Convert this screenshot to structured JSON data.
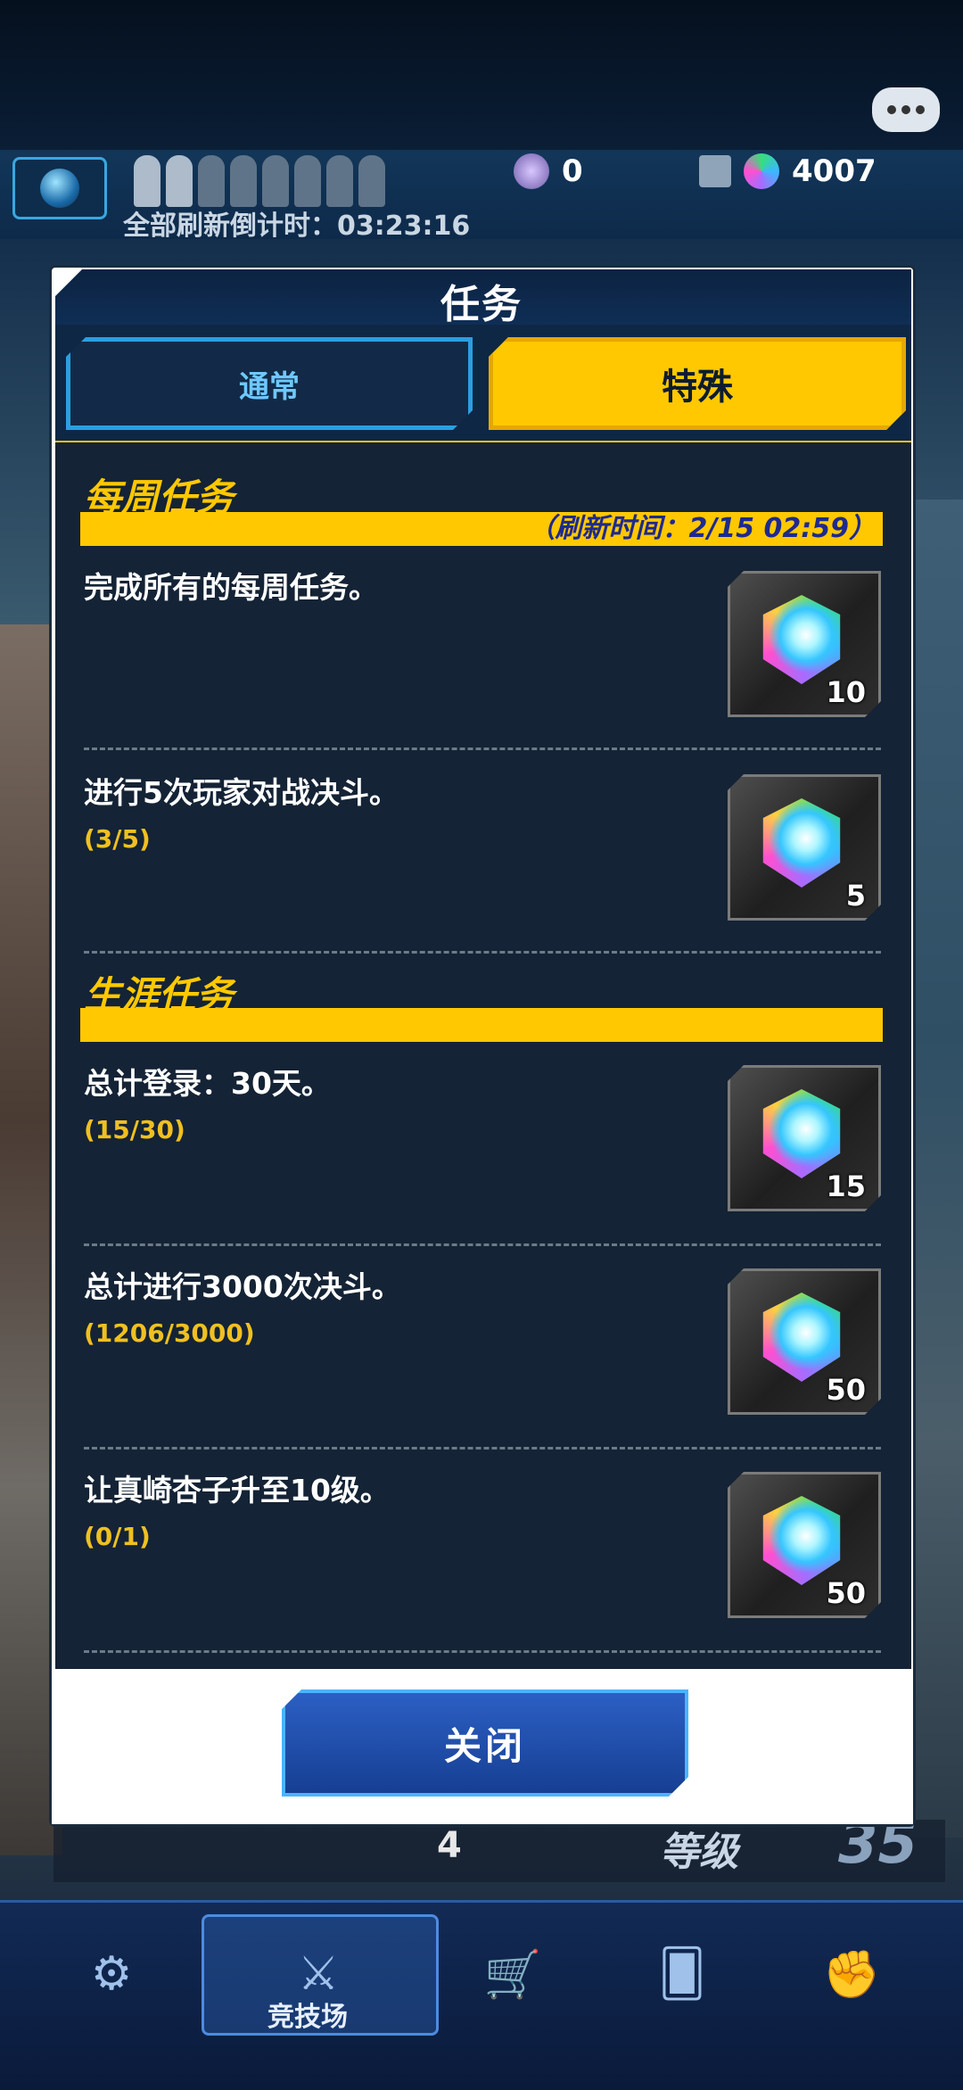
{
  "hud": {
    "refresh_countdown": "全部刷新倒计时：03:23:16",
    "currency_a": "0",
    "currency_b": "4007",
    "behind_number": "4",
    "behind_level_label": "等级",
    "behind_level_value": "35",
    "chat_icon": "chat-bubble-icon"
  },
  "dialog": {
    "title": "任务",
    "tabs": [
      {
        "label": "通常",
        "active": false
      },
      {
        "label": "特殊",
        "active": true
      }
    ],
    "sections": [
      {
        "title": "每周任务",
        "refresh_time": "（刷新时间：2/15 02:59）",
        "missions": [
          {
            "text": "完成所有的每周任务。",
            "progress": "",
            "reward": "10"
          },
          {
            "text": "进行5次玩家对战决斗。",
            "progress": "(3/5)",
            "reward": "5"
          }
        ]
      },
      {
        "title": "生涯任务",
        "refresh_time": "",
        "missions": [
          {
            "text": "总计登录：30天。",
            "progress": "(15/30)",
            "reward": "15"
          },
          {
            "text": "总计进行3000次决斗。",
            "progress": "(1206/3000)",
            "reward": "50"
          },
          {
            "text": "让真崎杏子升至10级。",
            "progress": "(0/1)",
            "reward": "50"
          }
        ]
      }
    ],
    "close_label": "关闭"
  },
  "bottom_nav": {
    "arena_label": "竞技场"
  },
  "colors": {
    "accent_yellow": "#ffc800",
    "panel_bg": "#142335",
    "progress_text": "#f0c020",
    "tab_blue": "#6ec8ff",
    "close_button": "#2c5fc4"
  }
}
